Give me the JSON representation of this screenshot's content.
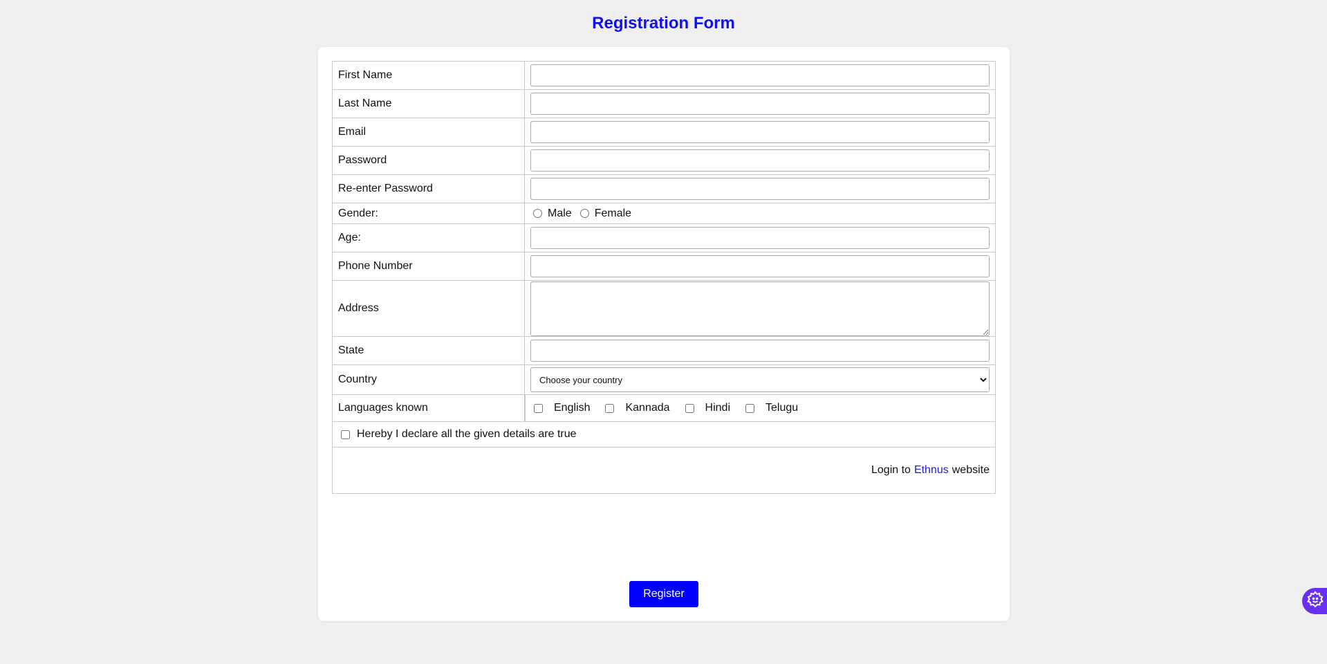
{
  "page": {
    "title": "Registration Form"
  },
  "form": {
    "rows": {
      "first_name": {
        "label": "First Name",
        "value": ""
      },
      "last_name": {
        "label": "Last Name",
        "value": ""
      },
      "email": {
        "label": "Email",
        "value": ""
      },
      "password": {
        "label": "Password",
        "value": ""
      },
      "re_password": {
        "label": "Re-enter Password",
        "value": ""
      },
      "gender": {
        "label": "Gender:",
        "options": [
          "Male",
          "Female"
        ]
      },
      "age": {
        "label": "Age:",
        "value": ""
      },
      "phone": {
        "label": "Phone Number",
        "value": ""
      },
      "address": {
        "label": "Address",
        "value": ""
      },
      "state": {
        "label": "State",
        "value": ""
      },
      "country": {
        "label": "Country",
        "selected": "Choose your country"
      },
      "languages": {
        "label": "Languages known",
        "options": [
          "English",
          "Kannada",
          "Hindi",
          "Telugu"
        ]
      }
    },
    "declaration": "Hereby I declare all the given details are true",
    "login": {
      "prefix": "Login to",
      "link_text": "Ethnus",
      "suffix": "website"
    },
    "register_label": "Register"
  },
  "floating_widget": {
    "icon": "gear-icon",
    "color": "#6a2ff0"
  },
  "colors": {
    "title": "#1010f0",
    "button": "#0000ff",
    "link": "#2020d0",
    "background": "#efefef"
  }
}
